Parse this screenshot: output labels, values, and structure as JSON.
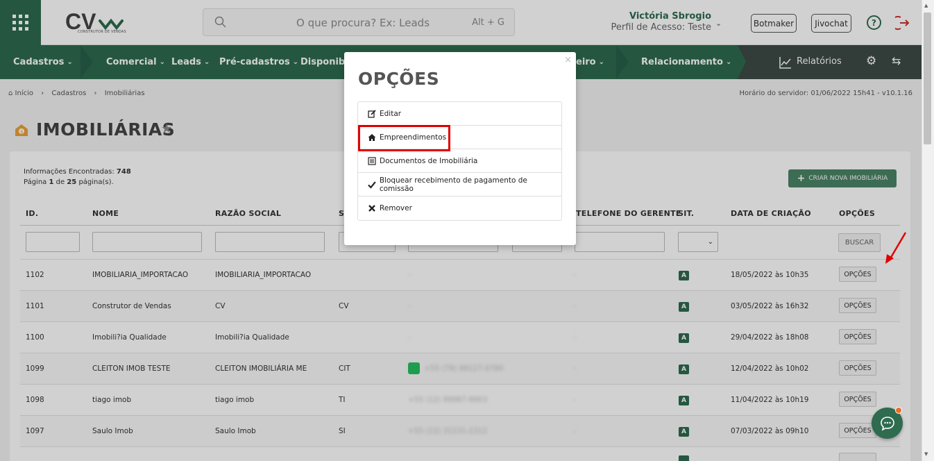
{
  "header": {
    "logo_text": "CV",
    "logo_subtitle": "CONSTRUTOR DE VENDAS",
    "search_placeholder": "O que procura? Ex: Leads",
    "search_shortcut": "Alt + G",
    "user_name": "Victória Sbrogio",
    "user_role": "Perfil de Acesso: Teste",
    "botmaker_label": "Botmaker",
    "jivochat_label": "Jivochat"
  },
  "nav": {
    "items": [
      {
        "label": "Cadastros"
      },
      {
        "label": "Comercial"
      },
      {
        "label": "Leads"
      },
      {
        "label": "Pré-cadastros"
      },
      {
        "label": "Disponibili"
      },
      {
        "label": "eiro"
      },
      {
        "label": "Relacionamento"
      }
    ],
    "reports_label": "Relatórios"
  },
  "breadcrumb": {
    "home": "Início",
    "level1": "Cadastros",
    "level2": "Imobiliárias"
  },
  "server_time": "Horário do servidor: 01/06/2022 15h41 - v10.1.16",
  "page": {
    "title": "IMOBILIÁRIAS",
    "info_found_label": "Informações Encontradas:",
    "info_found_count": "748",
    "page_label": "Página",
    "page_current": "1",
    "page_of": "de",
    "page_total": "25",
    "page_suffix": "página(s).",
    "create_button": "CRIAR NOVA IMOBILIÁRIA",
    "buscar_button": "BUSCAR"
  },
  "table": {
    "columns": {
      "id": "ID.",
      "nome": "NOME",
      "razao": "RAZÃO SOCIAL",
      "sigla": "S",
      "telefone_gerente": "TELEFONE DO GERENTE",
      "sit": "SIT.",
      "data": "DATA DE CRIAÇÃO",
      "opcoes": "OPÇÕES"
    },
    "rows": [
      {
        "id": "1102",
        "nome": "IMOBILIARIA_IMPORTACAO",
        "razao": "IMOBILIARIA_IMPORTACAO",
        "sigla": "",
        "tel": "-",
        "tel_gerente": "-",
        "sit": "A",
        "data": "18/05/2022 às 10h35",
        "opt": "OPÇÕES"
      },
      {
        "id": "1101",
        "nome": "Construtor de Vendas",
        "razao": "CV",
        "sigla": "CV",
        "tel": "-",
        "tel_gerente": "-",
        "sit": "A",
        "data": "03/05/2022 às 16h32",
        "opt": "OPÇÕES"
      },
      {
        "id": "1100",
        "nome": "Imobili?ia Qualidade",
        "razao": "Imobili?ia Qualidade",
        "sigla": "",
        "tel": "-",
        "tel_gerente": "-",
        "sit": "A",
        "data": "29/04/2022 às 18h08",
        "opt": "OPÇÕES"
      },
      {
        "id": "1099",
        "nome": "CLEITON IMOB TESTE",
        "razao": "CLEITON IMOBILIÁRIA ME",
        "sigla": "CIT",
        "tel": "+55 (79) 98127-0780",
        "tel_gerente": "-",
        "sit": "A",
        "data": "12/04/2022 às 10h02",
        "opt": "OPÇÕES"
      },
      {
        "id": "1098",
        "nome": "tiago imob",
        "razao": "tiago imob",
        "sigla": "TI",
        "tel": "+55 (12) 99987-8903",
        "tel_gerente": "-",
        "sit": "A",
        "data": "11/04/2022 às 10h19",
        "opt": "OPÇÕES"
      },
      {
        "id": "1097",
        "nome": "Saulo Imob",
        "razao": "Saulo Imob",
        "sigla": "SI",
        "tel": "+55 (12) 31231-2312",
        "tel_gerente": "-",
        "sit": "A",
        "data": "07/03/2022 às 09h10",
        "opt": "OPÇÕES"
      }
    ]
  },
  "modal": {
    "title": "OPÇÕES",
    "close": "×",
    "items": [
      {
        "label": "Editar",
        "icon": "edit-icon"
      },
      {
        "label": "Empreendimentos",
        "icon": "home-icon"
      },
      {
        "label": "Documentos de Imobiliária",
        "icon": "document-icon"
      },
      {
        "label": "Bloquear recebimento de pagamento de comissão",
        "icon": "check-icon"
      },
      {
        "label": "Remover",
        "icon": "remove-icon"
      }
    ]
  },
  "colors": {
    "brand_green": "#2e6b4f",
    "nav_dark": "#3e4a45",
    "highlight_red": "#e00000",
    "notify_orange": "#e8702a"
  }
}
